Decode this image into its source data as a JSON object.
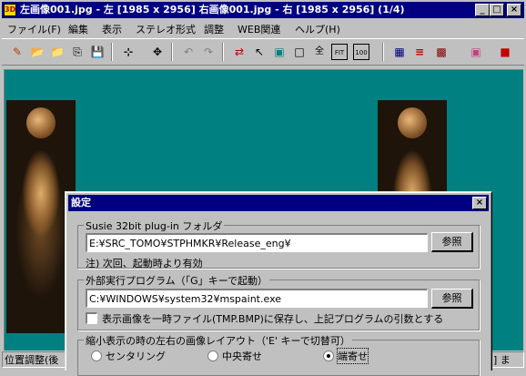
{
  "window": {
    "title": "左画像001.jpg - 左 [1985 x 2956] 右画像001.jpg - 右 [1985 x 2956]  (1/4)",
    "app_icon_text": "3D",
    "minimize": "_",
    "maximize": "□",
    "close": "×"
  },
  "menu": [
    {
      "label": "ファイル(F)"
    },
    {
      "label": "編集"
    },
    {
      "label": "表示"
    },
    {
      "label": "ステレオ形式"
    },
    {
      "label": "調整"
    },
    {
      "label": "WEB関連"
    },
    {
      "label": "ヘルプ(H)"
    }
  ],
  "toolbar": [
    {
      "icon": "new-icon",
      "glyph": "✎"
    },
    {
      "icon": "open-icon",
      "glyph": "📂"
    },
    {
      "icon": "open-folder-icon",
      "glyph": "📁"
    },
    {
      "icon": "copy-icon",
      "glyph": "⎘"
    },
    {
      "icon": "save-icon",
      "glyph": "💾"
    },
    {
      "icon": "crop-icon",
      "glyph": "⊹"
    },
    {
      "icon": "move-icon",
      "glyph": "✥"
    },
    {
      "icon": "undo-icon",
      "glyph": "↶"
    },
    {
      "icon": "redo-icon",
      "glyph": "↷"
    },
    {
      "icon": "swap-icon",
      "glyph": "⇄"
    },
    {
      "icon": "pointer-icon",
      "glyph": "↖"
    },
    {
      "icon": "screen-icon",
      "glyph": "▣"
    },
    {
      "icon": "window-icon",
      "glyph": "□"
    },
    {
      "icon": "fullscreen-icon",
      "glyph": "全"
    },
    {
      "icon": "fit-icon",
      "glyph": "FIT"
    },
    {
      "icon": "zoom-100-icon",
      "glyph": "100"
    },
    {
      "icon": "layout-grid-icon",
      "glyph": "▦"
    },
    {
      "icon": "interlace-icon",
      "glyph": "≡"
    },
    {
      "icon": "checker-icon",
      "glyph": "▩"
    },
    {
      "icon": "color-icon",
      "glyph": "▣"
    },
    {
      "icon": "anaglyph-icon",
      "glyph": "■"
    }
  ],
  "statusbar": {
    "left": "位置調整(後",
    "right": "] ま"
  },
  "dialog": {
    "title": "設定",
    "close": "×",
    "plugin": {
      "label": "Susie 32bit plug-in フォルダ",
      "path": "E:¥SRC_TOMO¥STPHMKR¥Release_eng¥",
      "browse": "参照",
      "note": "注) 次回、起動時より有効"
    },
    "external": {
      "label": "外部実行プログラム（「G」キーで起動）",
      "path": "C:¥WINDOWS¥system32¥mspaint.exe",
      "browse": "参照",
      "checkbox_label": "表示画像を一時ファイル(TMP.BMP)に保存し、上記プログラムの引数とする",
      "checked": false
    },
    "layout": {
      "label": "縮小表示の時の左右の画像レイアウト（'E' キーで切替可）",
      "options": [
        "センタリング",
        "中央寄せ",
        "端寄せ"
      ],
      "selected": "端寄せ"
    }
  }
}
